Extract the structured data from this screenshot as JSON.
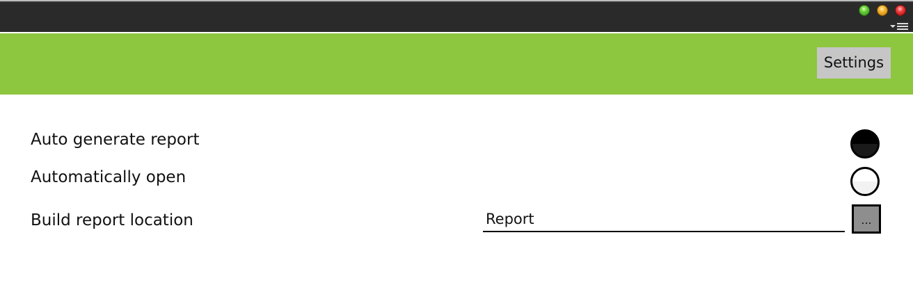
{
  "window": {
    "controls": [
      {
        "name": "minimize",
        "color": "#4cc126"
      },
      {
        "name": "maximize",
        "color": "#f7a521"
      },
      {
        "name": "close",
        "color": "#e52c2c"
      }
    ],
    "menu_icon": "dropdown-menu-icon"
  },
  "header": {
    "background": "#8dc63f",
    "settings_label": "Settings"
  },
  "settings": {
    "auto_generate": {
      "label": "Auto generate report",
      "checked": true
    },
    "auto_open": {
      "label": "Automatically open",
      "checked": false
    },
    "location": {
      "label": "Build report location",
      "value": "Report",
      "browse_label": "..."
    }
  }
}
